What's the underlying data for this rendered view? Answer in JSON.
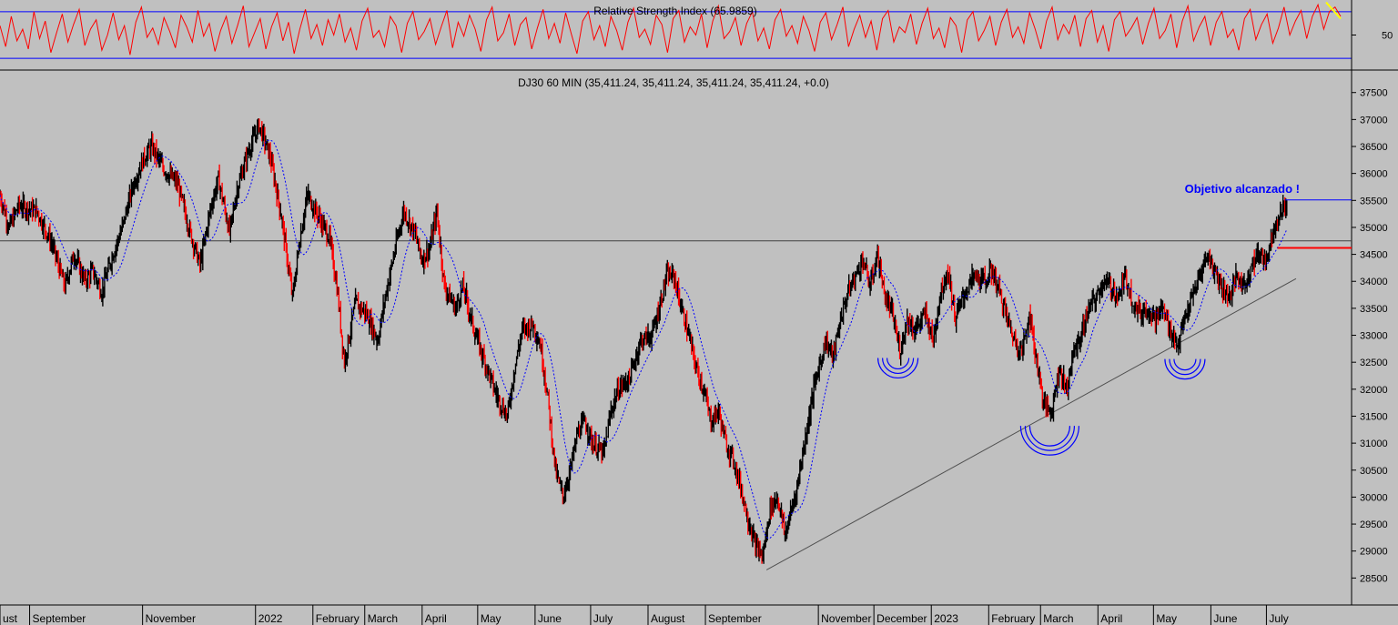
{
  "colors": {
    "background": "#c0c0c0",
    "price_bars": "#000000",
    "price_highlight": "#ff0000",
    "moving_average": "#0000ff",
    "rsi_line": "#ff0000",
    "rsi_bands": "#0000ff",
    "trendline": "#505050",
    "annotation": "#0000ff",
    "target_line": "#ff0000",
    "rsi_marker": "#ffff00"
  },
  "chart_data": [
    {
      "type": "line",
      "title": "Relative Strength Index (65.9859)",
      "ylim": [
        20,
        80
      ],
      "bands": [
        70,
        30
      ],
      "y_ticks": [
        50
      ],
      "series": [
        {
          "values": [
            58,
            40,
            66,
            45,
            55,
            38,
            70,
            47,
            62,
            35,
            52,
            68,
            44,
            59,
            72,
            41,
            55,
            63,
            37,
            50,
            69,
            46,
            58,
            33,
            61,
            74,
            48,
            56,
            42,
            65,
            53,
            39,
            67,
            57,
            44,
            71,
            49,
            60,
            36,
            54,
            66,
            43,
            58,
            75,
            40,
            52,
            64,
            38,
            57,
            69,
            45,
            61,
            34,
            55,
            72,
            47,
            59,
            41,
            63,
            50,
            68,
            44,
            56,
            37,
            62,
            73,
            48,
            54,
            40,
            66,
            58,
            35,
            60,
            70,
            46,
            53,
            64,
            42,
            57,
            71,
            39,
            61,
            49,
            67,
            55,
            36,
            63,
            74,
            45,
            52,
            68,
            41,
            59,
            65,
            38,
            56,
            72,
            47,
            60,
            43,
            69,
            51,
            34,
            62,
            70,
            46,
            58,
            40,
            66,
            54,
            37,
            61,
            73,
            48,
            55,
            42,
            67,
            59,
            35,
            64,
            71,
            44,
            57,
            50,
            68,
            39,
            62,
            75,
            47,
            53,
            65,
            41,
            60,
            70,
            45,
            56,
            38,
            63,
            72,
            49,
            58,
            43,
            66,
            54,
            36,
            61,
            69,
            46,
            59,
            74,
            40,
            55,
            67,
            48,
            62,
            37,
            64,
            71,
            44,
            57,
            52,
            68,
            42,
            60,
            73,
            47,
            56,
            39,
            65,
            58,
            35,
            63,
            70,
            45,
            54,
            66,
            41,
            61,
            72,
            48,
            57,
            43,
            69,
            55,
            38,
            62,
            74,
            46,
            59,
            51,
            67,
            40,
            64,
            71,
            44,
            58,
            36,
            63,
            70,
            49,
            56,
            65,
            42,
            60,
            73,
            47,
            54,
            68,
            39,
            62,
            75,
            45,
            57,
            66,
            41,
            61,
            70,
            48,
            55,
            37,
            64,
            72,
            46,
            59,
            68,
            43,
            56,
            74,
            50,
            62,
            71,
            47,
            66,
            76,
            55,
            70,
            74,
            66
          ]
        }
      ]
    },
    {
      "type": "bar",
      "title": "DJ30 60 MIN (35,411.24, 35,411.24, 35,411.24, 35,411.24, +0.0)",
      "ylim": [
        28000,
        37900
      ],
      "y_ticks": [
        28500,
        29000,
        29500,
        30000,
        30500,
        31000,
        31500,
        32000,
        32500,
        33000,
        33500,
        34000,
        34500,
        35000,
        35500,
        36000,
        36500,
        37000,
        37500
      ],
      "month_ticks": [
        {
          "label": "ust",
          "day": 0
        },
        {
          "label": "September",
          "day": 16
        },
        {
          "label": "November",
          "day": 77
        },
        {
          "label": "2022",
          "day": 138
        },
        {
          "label": "February",
          "day": 169
        },
        {
          "label": "March",
          "day": 197
        },
        {
          "label": "April",
          "day": 228
        },
        {
          "label": "May",
          "day": 258
        },
        {
          "label": "June",
          "day": 289
        },
        {
          "label": "July",
          "day": 319
        },
        {
          "label": "August",
          "day": 350
        },
        {
          "label": "September",
          "day": 381
        },
        {
          "label": "November",
          "day": 442
        },
        {
          "label": "December",
          "day": 472
        },
        {
          "label": "2023",
          "day": 503
        },
        {
          "label": "February",
          "day": 534
        },
        {
          "label": "March",
          "day": 562
        },
        {
          "label": "April",
          "day": 593
        },
        {
          "label": "May",
          "day": 623
        },
        {
          "label": "June",
          "day": 654
        },
        {
          "label": "July",
          "day": 684
        }
      ],
      "x_range_days": [
        0,
        730
      ],
      "price_path": [
        [
          0,
          35600
        ],
        [
          5,
          35000
        ],
        [
          10,
          35400
        ],
        [
          20,
          35300
        ],
        [
          28,
          34700
        ],
        [
          35,
          33900
        ],
        [
          40,
          34500
        ],
        [
          46,
          34000
        ],
        [
          50,
          34200
        ],
        [
          55,
          33800
        ],
        [
          60,
          34400
        ],
        [
          66,
          35000
        ],
        [
          72,
          35800
        ],
        [
          78,
          36300
        ],
        [
          82,
          36500
        ],
        [
          88,
          36100
        ],
        [
          96,
          35800
        ],
        [
          102,
          35000
        ],
        [
          108,
          34300
        ],
        [
          114,
          35400
        ],
        [
          118,
          35900
        ],
        [
          124,
          34900
        ],
        [
          128,
          35700
        ],
        [
          134,
          36400
        ],
        [
          140,
          36900
        ],
        [
          146,
          36300
        ],
        [
          152,
          35200
        ],
        [
          158,
          33700
        ],
        [
          162,
          34800
        ],
        [
          166,
          35600
        ],
        [
          172,
          35200
        ],
        [
          178,
          34800
        ],
        [
          182,
          33900
        ],
        [
          186,
          32500
        ],
        [
          192,
          33600
        ],
        [
          198,
          33400
        ],
        [
          204,
          32900
        ],
        [
          208,
          33700
        ],
        [
          214,
          34700
        ],
        [
          218,
          35300
        ],
        [
          224,
          34900
        ],
        [
          228,
          34400
        ],
        [
          232,
          34600
        ],
        [
          236,
          35300
        ],
        [
          240,
          33900
        ],
        [
          246,
          33500
        ],
        [
          250,
          33900
        ],
        [
          256,
          33100
        ],
        [
          262,
          32500
        ],
        [
          268,
          31900
        ],
        [
          274,
          31500
        ],
        [
          278,
          32400
        ],
        [
          282,
          33100
        ],
        [
          288,
          33200
        ],
        [
          292,
          32800
        ],
        [
          296,
          31800
        ],
        [
          300,
          30500
        ],
        [
          304,
          30000
        ],
        [
          308,
          30500
        ],
        [
          312,
          31200
        ],
        [
          316,
          31400
        ],
        [
          320,
          31000
        ],
        [
          326,
          30800
        ],
        [
          330,
          31600
        ],
        [
          334,
          32000
        ],
        [
          340,
          32200
        ],
        [
          346,
          32900
        ],
        [
          352,
          33000
        ],
        [
          356,
          33500
        ],
        [
          360,
          34100
        ],
        [
          364,
          34100
        ],
        [
          368,
          33500
        ],
        [
          372,
          33000
        ],
        [
          376,
          32400
        ],
        [
          380,
          32000
        ],
        [
          384,
          31400
        ],
        [
          388,
          31600
        ],
        [
          392,
          31000
        ],
        [
          396,
          30700
        ],
        [
          400,
          30200
        ],
        [
          404,
          29600
        ],
        [
          408,
          29100
        ],
        [
          412,
          28900
        ],
        [
          416,
          29800
        ],
        [
          420,
          30000
        ],
        [
          424,
          29300
        ],
        [
          430,
          30100
        ],
        [
          436,
          31300
        ],
        [
          440,
          32100
        ],
        [
          446,
          32900
        ],
        [
          450,
          32600
        ],
        [
          454,
          33300
        ],
        [
          458,
          33800
        ],
        [
          462,
          34100
        ],
        [
          466,
          34400
        ],
        [
          470,
          33900
        ],
        [
          474,
          34500
        ],
        [
          478,
          33700
        ],
        [
          482,
          33400
        ],
        [
          486,
          32700
        ],
        [
          490,
          33300
        ],
        [
          494,
          33100
        ],
        [
          500,
          33400
        ],
        [
          504,
          32900
        ],
        [
          508,
          33800
        ],
        [
          512,
          34200
        ],
        [
          516,
          33300
        ],
        [
          520,
          33700
        ],
        [
          526,
          34100
        ],
        [
          532,
          34000
        ],
        [
          536,
          34200
        ],
        [
          540,
          33800
        ],
        [
          544,
          33300
        ],
        [
          548,
          32900
        ],
        [
          552,
          32700
        ],
        [
          556,
          33400
        ],
        [
          560,
          32500
        ],
        [
          564,
          31700
        ],
        [
          568,
          31600
        ],
        [
          572,
          32400
        ],
        [
          576,
          32000
        ],
        [
          580,
          32700
        ],
        [
          584,
          33000
        ],
        [
          588,
          33500
        ],
        [
          592,
          33700
        ],
        [
          596,
          34000
        ],
        [
          600,
          33900
        ],
        [
          604,
          33700
        ],
        [
          608,
          34100
        ],
        [
          612,
          33600
        ],
        [
          616,
          33400
        ],
        [
          620,
          33500
        ],
        [
          624,
          33300
        ],
        [
          628,
          33500
        ],
        [
          632,
          33100
        ],
        [
          636,
          32800
        ],
        [
          640,
          33300
        ],
        [
          644,
          33700
        ],
        [
          648,
          34100
        ],
        [
          652,
          34500
        ],
        [
          656,
          34200
        ],
        [
          660,
          33900
        ],
        [
          664,
          33700
        ],
        [
          668,
          34100
        ],
        [
          672,
          33900
        ],
        [
          676,
          34300
        ],
        [
          680,
          34500
        ],
        [
          684,
          34400
        ],
        [
          688,
          35000
        ],
        [
          692,
          35300
        ],
        [
          695,
          35450
        ]
      ],
      "horizontal_line": 34750,
      "trendline": [
        [
          414,
          28650
        ],
        [
          700,
          34050
        ]
      ],
      "target_line": {
        "value": 35510,
        "from_day": 694,
        "to_day": 730
      },
      "resistance_line": {
        "value": 34620,
        "from_day": 690,
        "to_day": 730
      },
      "annotation": "Objetivo alcanzado !",
      "smile_marks": [
        {
          "day": 485,
          "value": 32580,
          "size": "small"
        },
        {
          "day": 567,
          "value": 31320,
          "size": "large"
        },
        {
          "day": 640,
          "value": 32560,
          "size": "small"
        }
      ]
    }
  ]
}
